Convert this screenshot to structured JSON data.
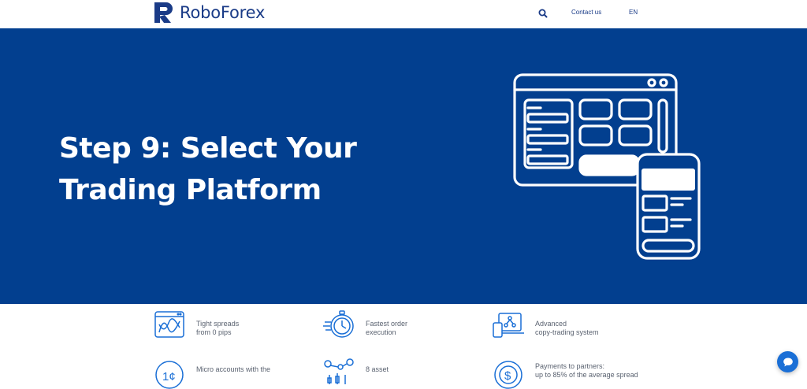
{
  "header": {
    "brand": "RoboForex",
    "contact_label": "Contact us",
    "lang_label": "EN"
  },
  "hero": {
    "title_line1": "Step 9: Select Your",
    "title_line2": "Trading Platform"
  },
  "features": [
    {
      "icon": "chart-icon",
      "line1": "Tight spreads",
      "line2": "from 0 pips"
    },
    {
      "icon": "stopwatch-icon",
      "line1": "Fastest order",
      "line2": "execution"
    },
    {
      "icon": "copy-trading-icon",
      "line1": "Advanced",
      "line2": "copy-trading system"
    },
    {
      "icon": "cent-coin-icon",
      "line1": "Micro accounts with the",
      "line2": ""
    },
    {
      "icon": "assets-icon",
      "line1": "8 asset",
      "line2": ""
    },
    {
      "icon": "dollar-coin-icon",
      "line1": "Payments to partners:",
      "line2": "up to 85% of the average spread"
    }
  ],
  "colors": {
    "hero_bg": "#023f8f",
    "brand_blue": "#1a3b87",
    "chat_blue": "#1a6fd6"
  }
}
